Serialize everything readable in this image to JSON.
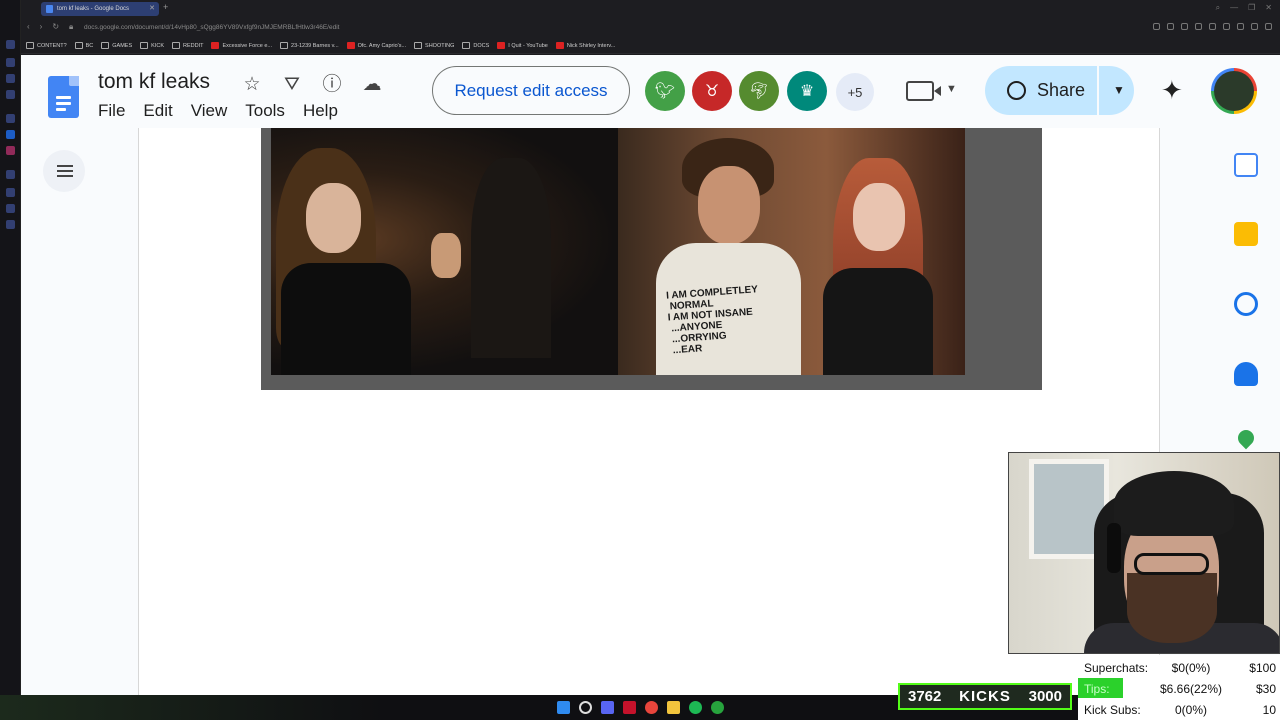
{
  "browser": {
    "tab_title": "tom kf leaks - Google Docs",
    "url": "docs.google.com/document/d/14vHp80_sQgg86YV89Vxfgf9nJMJEMRBLfHtlw3r46E/edit",
    "bookmarks": [
      "CONTENT?",
      "BC",
      "GAMES",
      "KICK",
      "REDDIT",
      "Excessive Force e...",
      "23-1239 Barnes v...",
      "Ofc. Amy Caprio's...",
      "SHOOTING",
      "DOCS",
      "I Quit - YouTube",
      "Nick Shirley Interv..."
    ]
  },
  "docs": {
    "title": "tom kf leaks",
    "menu": [
      "File",
      "Edit",
      "View",
      "Tools",
      "Help"
    ],
    "request_edit_label": "Request edit access",
    "more_collaborators": "+5",
    "share_label": "Share",
    "shirt_text": "I AM COMPLETLEY\n NORMAL\nI AM NOT INSANE\n ...ANYONE\n ...ORRYING\n ...EAR"
  },
  "overlay": {
    "kicks_current": "3762",
    "kicks_label": "KICKS",
    "kicks_goal": "3000",
    "stats": [
      {
        "name": "Superchats:",
        "value": "$0(0%)",
        "goal": "$100"
      },
      {
        "name": "Tips:",
        "value": "$6.66(22%)",
        "goal": "$30"
      },
      {
        "name": "Kick Subs:",
        "value": "0(0%)",
        "goal": "10"
      }
    ]
  },
  "colors": {
    "kick_green": "#53fc18",
    "share_bg": "#c2e7ff",
    "request_text": "#0b57d0"
  }
}
